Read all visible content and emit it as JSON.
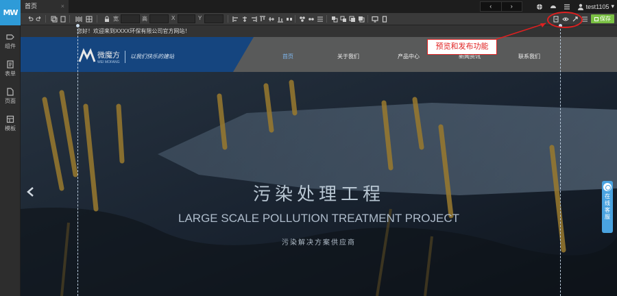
{
  "app": {
    "logo_text": "MW",
    "colors": {
      "accent": "#2e9bd8",
      "save": "#7ac043",
      "annotation": "#e02020",
      "brand": "#15457f"
    }
  },
  "sidebar": {
    "items": [
      {
        "label": "组件",
        "icon": "component-icon"
      },
      {
        "label": "表单",
        "icon": "form-icon"
      },
      {
        "label": "页面",
        "icon": "page-icon"
      },
      {
        "label": "模板",
        "icon": "template-icon"
      }
    ]
  },
  "topbar": {
    "tab_label": "首页",
    "tab_close": "×",
    "prev": "‹",
    "next": "›",
    "username": "test1105",
    "user_caret": "▾"
  },
  "toolbar": {
    "width_label": "宽",
    "height_label": "高",
    "x_label": "X",
    "y_label": "Y",
    "save_label": "保存"
  },
  "site": {
    "notice": "您好！欢迎来到XXXX环保有限公司官方网站！",
    "brand_name": "微魔方",
    "brand_sub": "WEI MOFANG",
    "brand_slogan": "以我们快乐的建站",
    "menu": [
      "首页",
      "关于我们",
      "产品中心",
      "新闻资讯",
      "联系我们"
    ],
    "active_menu": "首页"
  },
  "hero": {
    "title_cn": "污染处理工程",
    "title_en": "LARGE SCALE POLLUTION TREATMENT PROJECT",
    "subtitle": "污染解决方案供应商"
  },
  "annotation": {
    "text": "预览和发布功能"
  },
  "online_service": {
    "label": "在线客服"
  }
}
